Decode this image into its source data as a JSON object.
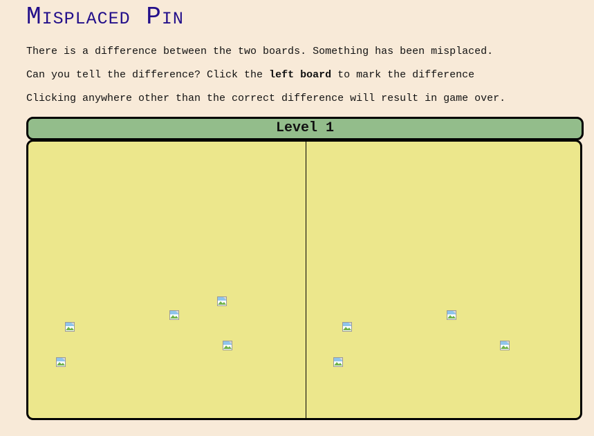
{
  "title": "Misplaced Pin",
  "instructions": {
    "line1": "There is a difference between the two boards. Something has been misplaced.",
    "line2_before": "Can you tell the difference? Click the ",
    "line2_bold": "left board",
    "line2_after": " to mark the difference",
    "line3": "Clicking anywhere other than the correct difference will result in game over."
  },
  "level": {
    "label": "Level 1"
  },
  "boards": {
    "left": {
      "pin_icon": "broken-image-icon",
      "pin_count": 5
    },
    "right": {
      "pin_icon": "broken-image-icon",
      "pin_count": 4
    }
  },
  "colors": {
    "background": "#f8ead8",
    "title": "#230f8a",
    "level_bar": "#93bd8b",
    "board": "#ece78c",
    "border": "#000000"
  }
}
